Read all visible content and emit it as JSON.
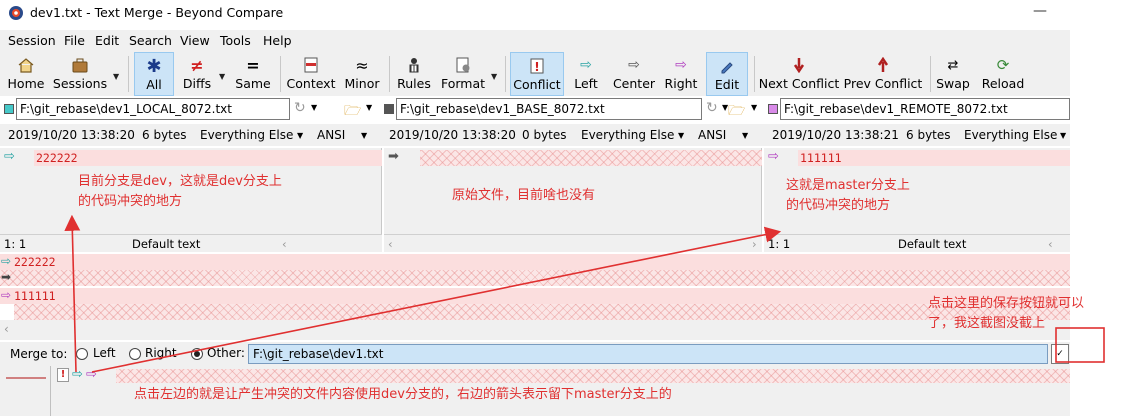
{
  "window": {
    "title": "dev1.txt - Text Merge - Beyond Compare",
    "minimize": "—"
  },
  "menu": [
    "Session",
    "File",
    "Edit",
    "Search",
    "View",
    "Tools",
    "Help"
  ],
  "toolbar": {
    "home": "Home",
    "sessions": "Sessions",
    "all": "All",
    "diffs": "Diffs",
    "same": "Same",
    "context": "Context",
    "minor": "Minor",
    "rules": "Rules",
    "format": "Format",
    "conflict": "Conflict",
    "left": "Left",
    "center": "Center",
    "right": "Right",
    "edit": "Edit",
    "next_conflict": "Next Conflict",
    "prev_conflict": "Prev Conflict",
    "swap": "Swap",
    "reload": "Reload"
  },
  "paths": {
    "local": "F:\\git_rebase\\dev1_LOCAL_8072.txt",
    "base": "F:\\git_rebase\\dev1_BASE_8072.txt",
    "remote": "F:\\git_rebase\\dev1_REMOTE_8072.txt"
  },
  "info": {
    "local": {
      "date": "2019/10/20 13:38:20",
      "size": "6 bytes",
      "filter": "Everything Else",
      "enc": "ANSI"
    },
    "base": {
      "date": "2019/10/20 13:38:20",
      "size": "0 bytes",
      "filter": "Everything Else",
      "enc": "ANSI"
    },
    "remote": {
      "date": "2019/10/20 13:38:21",
      "size": "6 bytes",
      "filter": "Everything Else"
    }
  },
  "panes": {
    "local_line": "222222",
    "remote_line": "111111",
    "local_pos": "1: 1",
    "local_format": "Default text",
    "remote_pos": "1: 1",
    "remote_format": "Default text"
  },
  "combined": {
    "line1": "222222",
    "line3": "111111"
  },
  "merge": {
    "label": "Merge to:",
    "opt_left": "Left",
    "opt_right": "Right",
    "opt_other": "Other:",
    "path": "F:\\git_rebase\\dev1.txt"
  },
  "annotations": {
    "a1_l1": "目前分支是dev，这就是dev分支上",
    "a1_l2": "的代码冲突的地方",
    "a2": "原始文件，目前啥也没有",
    "a3_l1": "这就是master分支上",
    "a3_l2": "的代码冲突的地方",
    "a4_l1": "点击这里的保存按钮就可以",
    "a4_l2": "了，我这截图没截上",
    "a5": "点击左边的就是让产生冲突的文件内容使用dev分支的，右边的箭头表示留下master分支上的"
  },
  "colors": {
    "accent_red": "#e03030",
    "local_swatch": "#46c9c9",
    "base_swatch": "#555555",
    "remote_swatch": "#d88ae8"
  }
}
